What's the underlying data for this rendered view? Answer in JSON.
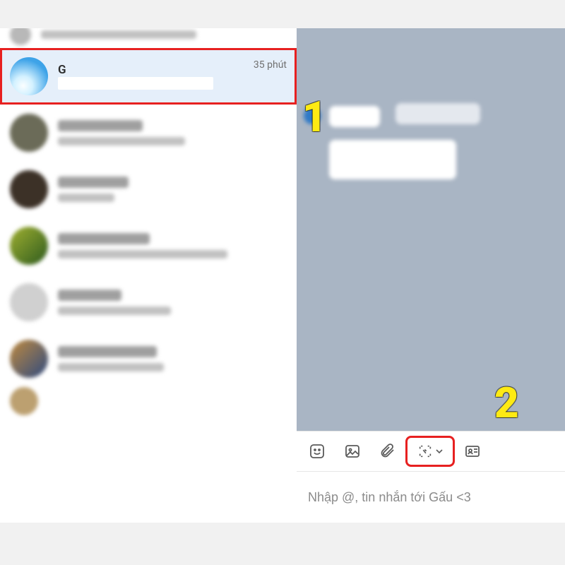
{
  "sidebar": {
    "items": [
      {
        "name": "G",
        "sub": "",
        "time": "35 phút",
        "selected": true
      },
      {
        "name": "",
        "sub": "",
        "time": ""
      },
      {
        "name": "",
        "sub": "",
        "time": ""
      },
      {
        "name": "",
        "sub": "",
        "time": ""
      },
      {
        "name": "",
        "sub": "",
        "time": ""
      },
      {
        "name": "",
        "sub": "",
        "time": ""
      }
    ]
  },
  "composer": {
    "placeholder": "Nhập @, tin nhắn tới Gấu <3",
    "value": ""
  },
  "toolbar": {
    "sticker": "sticker",
    "image": "image",
    "attach": "attach",
    "capture": "screenshot",
    "namecard": "namecard"
  },
  "annotations": {
    "one": "1",
    "two": "2"
  },
  "colors": {
    "highlight_box": "#e72020",
    "annotation_text": "#feea13",
    "selected_row_bg": "#e5effa"
  }
}
